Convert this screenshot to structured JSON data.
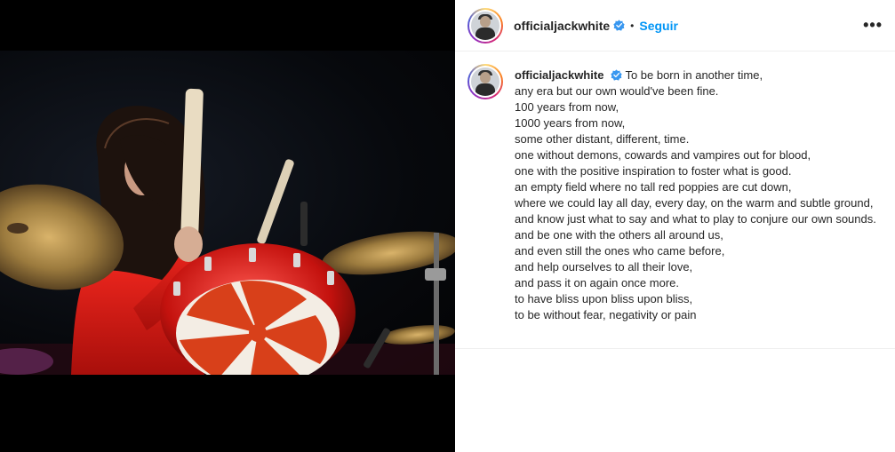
{
  "post": {
    "username": "officialjackwhite",
    "follow_label": "Seguir",
    "separator": "•",
    "more_label": "•••",
    "icons": {
      "verified": "verified-badge-icon",
      "more": "more-options-icon"
    },
    "colors": {
      "follow": "#0095f6",
      "verified": "#3897f0"
    }
  },
  "caption": {
    "username": "officialjackwhite",
    "lines": [
      "To be born in another time,",
      "any era but our own would've been fine.",
      "100 years from now,",
      "1000 years from now,",
      "some other distant, different, time.",
      "one without demons, cowards and vampires out for blood,",
      "one with the positive inspiration to foster what is good.",
      "an empty field where no tall red poppies are cut down,",
      "where we could lay all day, every day, on the warm and subtle ground,",
      "and know just what to say and what to play to conjure our own sounds.",
      "and be one with the others all around us,",
      "and even still the ones who came before,",
      "and help ourselves to all their love,",
      "and pass it on again once more.",
      "to have bliss upon bliss upon bliss,",
      "to be without fear, negativity or pain"
    ]
  }
}
